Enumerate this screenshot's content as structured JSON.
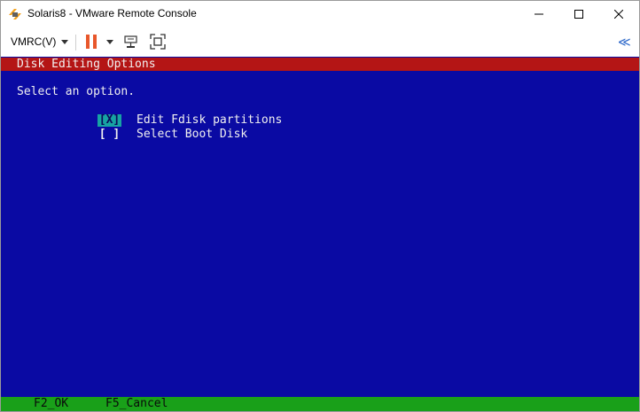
{
  "window": {
    "title": "Solaris8 - VMware Remote Console"
  },
  "toolbar": {
    "vmrc_menu_label": "VMRC(V)"
  },
  "console": {
    "header_title": "Disk Editing Options",
    "prompt": "Select an option.",
    "options": [
      {
        "checkbox": "[X]",
        "label": "Edit Fdisk partitions",
        "selected": true
      },
      {
        "checkbox": "[ ]",
        "label": "Select Boot Disk",
        "selected": false
      }
    ],
    "footer_keys": [
      "F2_OK",
      "F5_Cancel"
    ]
  },
  "colors": {
    "console_bg": "#0a0aa3",
    "header_bg": "#b41515",
    "footer_bg": "#19a019",
    "highlight": "#17a3a3",
    "pause": "#e8572b"
  },
  "icons": [
    "vmware-app-icon",
    "minimize-icon",
    "maximize-icon",
    "close-icon",
    "pause-icon",
    "chevron-down-icon",
    "send-ctrl-alt-del-icon",
    "fullscreen-icon",
    "collapse-toolbar-icon"
  ]
}
